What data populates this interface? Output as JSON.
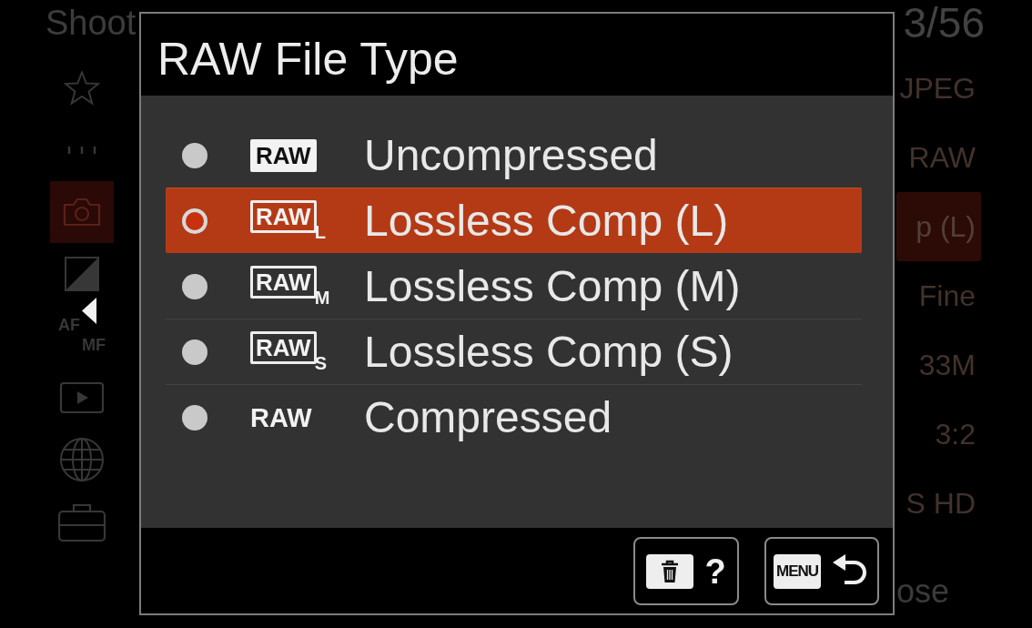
{
  "background_menu": {
    "title": "Shoot",
    "page": "3/56",
    "sidebar": [
      {
        "kind": "star",
        "selected": false
      },
      {
        "kind": "dots",
        "selected": false
      },
      {
        "kind": "camera",
        "selected": true
      },
      {
        "kind": "exposure",
        "selected": false
      },
      {
        "kind": "af-mf",
        "selected": false,
        "labels": [
          "AF",
          "MF"
        ]
      },
      {
        "kind": "play",
        "selected": false
      },
      {
        "kind": "globe",
        "selected": false
      },
      {
        "kind": "toolbox",
        "selected": false
      }
    ],
    "values": [
      {
        "text": "JPEG",
        "selected": false
      },
      {
        "text": "RAW",
        "selected": false
      },
      {
        "text": "p (L)",
        "selected": true
      },
      {
        "text": "Fine",
        "selected": false
      },
      {
        "text": "33M",
        "selected": false
      },
      {
        "text": "3:2",
        "selected": false
      },
      {
        "text": "S HD",
        "selected": false
      }
    ],
    "footer_text": "ose"
  },
  "dialog": {
    "title": "RAW File Type",
    "options": [
      {
        "badge": {
          "kind": "filled",
          "text": "RAW"
        },
        "label": "Uncompressed",
        "selected": false
      },
      {
        "badge": {
          "kind": "outlined",
          "text": "RAW",
          "sub": "L"
        },
        "label": "Lossless Comp (L)",
        "selected": true
      },
      {
        "badge": {
          "kind": "outlined",
          "text": "RAW",
          "sub": "M"
        },
        "label": "Lossless Comp (M)",
        "selected": false
      },
      {
        "badge": {
          "kind": "outlined",
          "text": "RAW",
          "sub": "S"
        },
        "label": "Lossless Comp (S)",
        "selected": false
      },
      {
        "badge": {
          "kind": "plain",
          "text": "RAW"
        },
        "label": "Compressed",
        "selected": false
      }
    ],
    "buttons": [
      {
        "kind": "help",
        "text": "?"
      },
      {
        "kind": "back",
        "text": "MENU"
      }
    ]
  }
}
